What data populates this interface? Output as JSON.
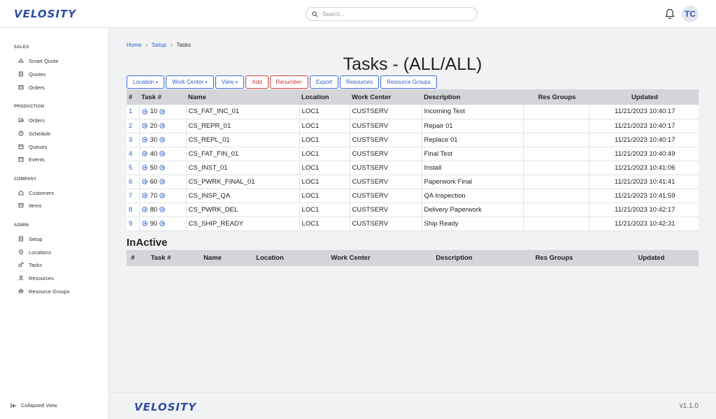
{
  "app": {
    "logo_text": "VELOSITY",
    "brand_color": "#2f4ca3",
    "accent_color": "#f28c1e"
  },
  "topbar": {
    "search_placeholder": "Search...",
    "avatar_initials": "TC"
  },
  "sidebar": {
    "sections": [
      {
        "title": "SALES",
        "items": [
          {
            "label": "Smart Quote",
            "icon": "smart-quote-icon"
          },
          {
            "label": "Quotes",
            "icon": "quotes-icon"
          },
          {
            "label": "Orders",
            "icon": "orders-icon"
          }
        ]
      },
      {
        "title": "PRODUCTION",
        "items": [
          {
            "label": "Orders",
            "icon": "truck-icon"
          },
          {
            "label": "Schedule",
            "icon": "clock-icon"
          },
          {
            "label": "Queues",
            "icon": "calendar-icon"
          },
          {
            "label": "Events",
            "icon": "calendar-icon"
          }
        ]
      },
      {
        "title": "COMPANY",
        "items": [
          {
            "label": "Customers",
            "icon": "home-icon"
          },
          {
            "label": "Items",
            "icon": "box-icon"
          }
        ]
      },
      {
        "title": "ADMIN",
        "items": [
          {
            "label": "Setup",
            "icon": "document-icon"
          },
          {
            "label": "Locations",
            "icon": "location-pin-icon"
          },
          {
            "label": "Tasks",
            "icon": "tasks-icon"
          },
          {
            "label": "Resources",
            "icon": "person-icon"
          },
          {
            "label": "Resource Groups",
            "icon": "group-icon"
          }
        ]
      }
    ],
    "collapse_label": "Collapsed View"
  },
  "breadcrumb": {
    "home": "Home",
    "setup": "Setup",
    "current": "Tasks"
  },
  "page_title": "Tasks - (ALL/ALL)",
  "toolbar": {
    "location": "Location",
    "work_center": "Work Center",
    "view": "View",
    "add": "Add",
    "renumber": "Renumber",
    "export": "Export",
    "resources": "Resources",
    "resource_groups": "Resource Groups"
  },
  "tasks_table": {
    "headers": [
      "#",
      "Task #",
      "Name",
      "Location",
      "Work Center",
      "Description",
      "Res Groups",
      "Updated"
    ],
    "rows": [
      {
        "num": "1",
        "task": "10",
        "name": "CS_FAT_INC_01",
        "location": "LOC1",
        "work_center": "CUSTSERV",
        "description": "Incoming Test",
        "res_groups": "",
        "updated": "11/21/2023 10:40:17"
      },
      {
        "num": "2",
        "task": "20",
        "name": "CS_REPR_01",
        "location": "LOC1",
        "work_center": "CUSTSERV",
        "description": "Repair 01",
        "res_groups": "",
        "updated": "11/21/2023 10:40:17"
      },
      {
        "num": "3",
        "task": "30",
        "name": "CS_REPL_01",
        "location": "LOC1",
        "work_center": "CUSTSERV",
        "description": "Replace 01",
        "res_groups": "",
        "updated": "11/21/2023 10:40:17"
      },
      {
        "num": "4",
        "task": "40",
        "name": "CS_FAT_FIN_01",
        "location": "LOC1",
        "work_center": "CUSTSERV",
        "description": "Final Test",
        "res_groups": "",
        "updated": "11/21/2023 10:40:49"
      },
      {
        "num": "5",
        "task": "50",
        "name": "CS_INST_01",
        "location": "LOC1",
        "work_center": "CUSTSERV",
        "description": "Install",
        "res_groups": "",
        "updated": "11/21/2023 10:41:06"
      },
      {
        "num": "6",
        "task": "60",
        "name": "CS_PWRK_FINAL_01",
        "location": "LOC1",
        "work_center": "CUSTSERV",
        "description": "Paperwork Final",
        "res_groups": "",
        "updated": "11/21/2023 10:41:41"
      },
      {
        "num": "7",
        "task": "70",
        "name": "CS_INSP_QA",
        "location": "LOC1",
        "work_center": "CUSTSERV",
        "description": "QA Inspection",
        "res_groups": "",
        "updated": "11/21/2023 10:41:59"
      },
      {
        "num": "8",
        "task": "80",
        "name": "CS_PWRK_DEL",
        "location": "LOC1",
        "work_center": "CUSTSERV",
        "description": "Delivery Paperwork",
        "res_groups": "",
        "updated": "11/21/2023 10:42:17"
      },
      {
        "num": "9",
        "task": "90",
        "name": "CS_SHIP_READY",
        "location": "LOC1",
        "work_center": "CUSTSERV",
        "description": "Ship Ready",
        "res_groups": "",
        "updated": "11/21/2023 10:42:31"
      }
    ]
  },
  "inactive": {
    "title": "InActive",
    "headers": [
      "#",
      "Task #",
      "Name",
      "Location",
      "Work Center",
      "Description",
      "Res Groups",
      "Updated"
    ]
  },
  "footer": {
    "version": "v1.1.0"
  }
}
